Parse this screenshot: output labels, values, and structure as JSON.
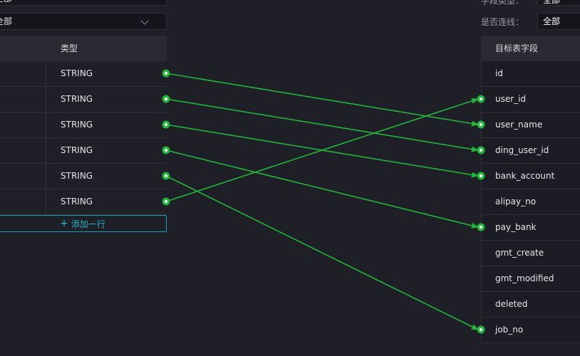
{
  "filters": {
    "field_type_label": "字段类型：",
    "field_type_value": "全部",
    "connected_label": "是否连线：",
    "connected_value": "全部",
    "left_top_value": "全部",
    "left_second_value": "全部"
  },
  "source_table": {
    "header_type": "类型",
    "rows": [
      {
        "type": "STRING"
      },
      {
        "type": "STRING"
      },
      {
        "type": "STRING"
      },
      {
        "type": "STRING"
      },
      {
        "type": "STRING"
      },
      {
        "type": "STRING"
      }
    ],
    "add_row_label": "添加一行"
  },
  "target_table": {
    "header": "目标表字段",
    "rows": [
      {
        "name": "id"
      },
      {
        "name": "user_id"
      },
      {
        "name": "user_name"
      },
      {
        "name": "ding_user_id"
      },
      {
        "name": "bank_account"
      },
      {
        "name": "alipay_no"
      },
      {
        "name": "pay_bank"
      },
      {
        "name": "gmt_create"
      },
      {
        "name": "gmt_modified"
      },
      {
        "name": "deleted"
      },
      {
        "name": "job_no"
      }
    ]
  },
  "mappings": [
    {
      "source": 0,
      "target": 2
    },
    {
      "source": 1,
      "target": 3
    },
    {
      "source": 2,
      "target": 4
    },
    {
      "source": 3,
      "target": 6
    },
    {
      "source": 4,
      "target": 10
    },
    {
      "source": 5,
      "target": 1
    }
  ],
  "colors": {
    "connector": "#21b53a",
    "accent": "#1ba0b5"
  }
}
